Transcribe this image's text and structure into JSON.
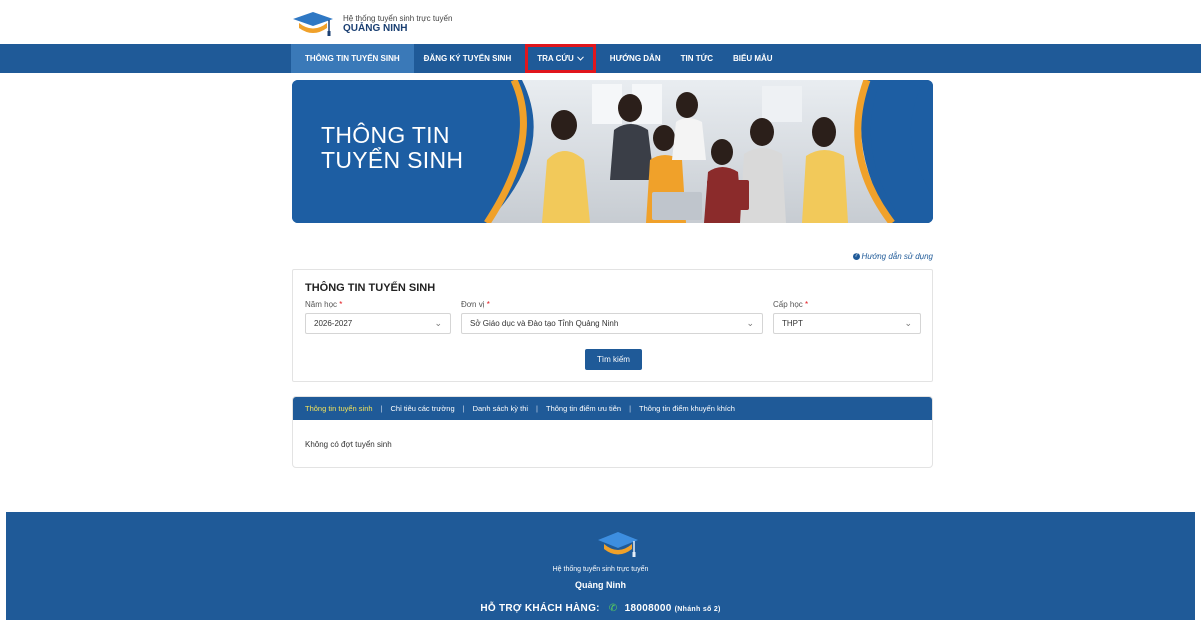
{
  "header": {
    "logo_subtitle": "Hệ thống tuyển sinh trực tuyến",
    "logo_name": "QUẢNG NINH"
  },
  "nav": {
    "items": [
      {
        "label": "THÔNG TIN TUYỂN SINH"
      },
      {
        "label": "ĐĂNG KÝ TUYỂN SINH"
      },
      {
        "label": "TRA CỨU"
      },
      {
        "label": "HƯỚNG DẪN"
      },
      {
        "label": "TIN TỨC"
      },
      {
        "label": "BIỂU MẪU"
      }
    ],
    "dropdown_icon": "chevron-down-icon"
  },
  "banner": {
    "line1": "THÔNG TIN",
    "line2": "TUYỂN SINH"
  },
  "help": {
    "icon": "info-icon",
    "label": "Hướng dẫn sử dụng"
  },
  "search": {
    "title": "THÔNG TIN TUYỂN SINH",
    "year_label": "Năm học",
    "year_value": "2026-2027",
    "unit_label": "Đơn vị",
    "unit_value": "Sở Giáo dục và Đào tạo Tỉnh Quảng Ninh",
    "level_label": "Cấp học",
    "level_value": "THPT",
    "required_mark": "*",
    "button_label": "Tìm kiếm"
  },
  "results": {
    "tabs": [
      {
        "label": "Thông tin tuyển sinh"
      },
      {
        "label": "Chỉ tiêu các trường"
      },
      {
        "label": "Danh sách kỳ thi"
      },
      {
        "label": "Thông tin điểm ưu tiên"
      },
      {
        "label": "Thông tin điểm khuyến khích"
      }
    ],
    "separator": "|",
    "empty_text": "Không có đợt tuyển sinh"
  },
  "footer": {
    "subtitle": "Hệ thống tuyển sinh trực tuyến",
    "name": "Quảng Ninh",
    "support_label": "HỖ TRỢ KHÁCH HÀNG:",
    "phone": "18008000",
    "phone_note": "(Nhánh số 2)",
    "phone_icon": "phone-icon"
  },
  "colors": {
    "primary": "#1f5a98",
    "active_tab": "#f2e35a",
    "highlight": "#e1161c",
    "accent_orange": "#f0a12a"
  }
}
